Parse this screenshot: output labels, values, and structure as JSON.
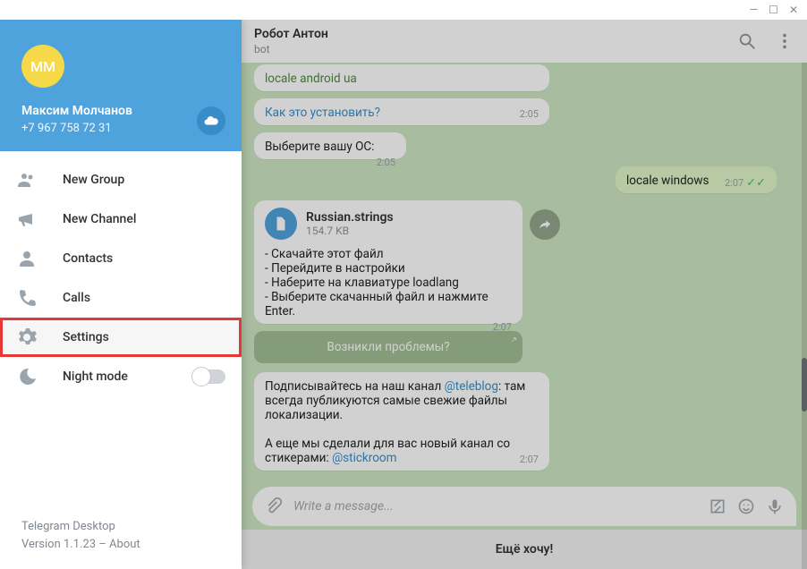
{
  "window": {
    "minimize": "—",
    "maximize": "☐",
    "close": "✕"
  },
  "sidebar": {
    "avatar_initials": "ММ",
    "user_name": "Максим Молчанов",
    "user_phone": "+7 967 758 72 31",
    "items": [
      {
        "label": "New Group"
      },
      {
        "label": "New Channel"
      },
      {
        "label": "Contacts"
      },
      {
        "label": "Calls"
      },
      {
        "label": "Settings"
      },
      {
        "label": "Night mode"
      }
    ],
    "footer_app": "Telegram Desktop",
    "footer_version": "Version 1.1.23 – About"
  },
  "chat": {
    "title": "Робот Антон",
    "subtitle": "bot",
    "messages": {
      "m0_code": "locale android ua",
      "m1_link": "Как это установить?",
      "m1_time": "2:05",
      "m2_text": "Выберите вашу ОС:",
      "m2_time": "2:05",
      "m3_out": "locale windows",
      "m3_time": "2:07",
      "m4_file_name": "Russian.strings",
      "m4_file_size": "154.7 KB",
      "m4_body": "- Скачайте этот файл\n- Перейдите в настройки\n- Наберите на клавиатуре loadlang\n- Выберите скачанный файл и нажмите Enter.",
      "m4_time": "2:07",
      "banner": "Возникли проблемы?",
      "m5_p1a": "Подписывайтесь на наш канал ",
      "m5_link1": "@teleblog",
      "m5_p1b": ": там всегда публикуются самые свежие файлы локализации.",
      "m5_p2a": "А еще мы сделали для вас новый канал со стикерами: ",
      "m5_link2": "@stickroom",
      "m5_time": "2:07"
    },
    "composer_placeholder": "Write a message...",
    "bot_button": "Ещё хочу!"
  }
}
